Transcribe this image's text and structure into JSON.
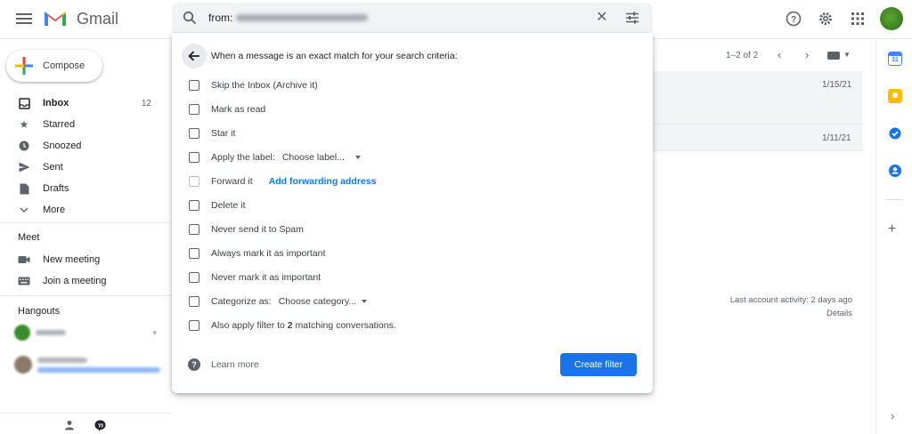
{
  "app": {
    "name": "Gmail"
  },
  "search": {
    "query": "from:"
  },
  "sidebar": {
    "compose_label": "Compose",
    "items": [
      {
        "label": "Inbox",
        "count": "12",
        "icon": "inbox-icon"
      },
      {
        "label": "Starred",
        "icon": "star-icon"
      },
      {
        "label": "Snoozed",
        "icon": "clock-icon"
      },
      {
        "label": "Sent",
        "icon": "send-icon"
      },
      {
        "label": "Drafts",
        "icon": "draft-icon"
      },
      {
        "label": "More",
        "icon": "chevron-down-icon"
      }
    ],
    "meet": {
      "title": "Meet",
      "items": [
        {
          "label": "New meeting",
          "icon": "video-icon"
        },
        {
          "label": "Join a meeting",
          "icon": "keyboard-icon"
        }
      ]
    },
    "hangouts": {
      "title": "Hangouts"
    }
  },
  "list": {
    "pager": "1–2 of 2",
    "rows": [
      {
        "date": "1/15/21"
      },
      {
        "date": "1/11/21"
      }
    ],
    "activity": {
      "line1": "Last account activity: 2 days ago",
      "details": "Details"
    }
  },
  "filter": {
    "header": "When a message is an exact match for your search criteria:",
    "options": [
      {
        "label": "Skip the Inbox (Archive it)"
      },
      {
        "label": "Mark as read"
      },
      {
        "label": "Star it"
      },
      {
        "label": "Apply the label:",
        "select": "Choose label..."
      },
      {
        "label": "Forward it",
        "link": "Add forwarding address"
      },
      {
        "label": "Delete it"
      },
      {
        "label": "Never send it to Spam"
      },
      {
        "label": "Always mark it as important"
      },
      {
        "label": "Never mark it as important"
      },
      {
        "label": "Categorize as:",
        "select": "Choose category..."
      },
      {
        "label_prefix": "Also apply filter to ",
        "label_bold": "2",
        "label_suffix": " matching conversations."
      }
    ],
    "learn_more": "Learn more",
    "create_button": "Create filter"
  },
  "colors": {
    "accent": "#1a73e8",
    "gmail_red": "#ea4335",
    "calendar_blue": "#4285f4",
    "keep_yellow": "#fbbc04",
    "tasks_blue": "#1a73e8",
    "contacts_blue": "#1a73e8"
  }
}
